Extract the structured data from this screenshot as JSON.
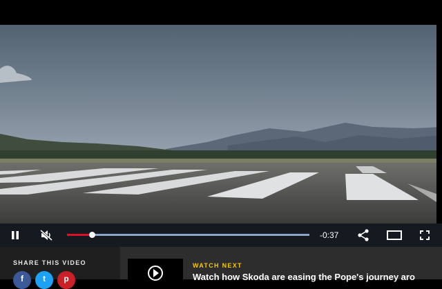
{
  "player": {
    "progress_fraction": 0.102,
    "time_remaining": "-0:37",
    "muted": true,
    "playing": true
  },
  "icons": {
    "pause": "pause-icon",
    "mute": "muted-speaker-icon",
    "share": "share-icon",
    "theater": "theater-mode-icon",
    "fullscreen": "fullscreen-icon"
  },
  "share": {
    "title": "SHARE THIS VIDEO",
    "networks": [
      {
        "name": "facebook",
        "glyph": "f",
        "color": "#3b5998"
      },
      {
        "name": "twitter",
        "glyph": "t",
        "color": "#1da1f2"
      },
      {
        "name": "pinterest",
        "glyph": "p",
        "color": "#cb2027"
      }
    ]
  },
  "up_next": {
    "label": "WATCH NEXT",
    "title": "Watch how Skoda are easing the Pope's journey aro"
  },
  "colors": {
    "progress_fill": "#e0102a",
    "progress_track": "#8ea3c9",
    "accent_label": "#f3c813"
  }
}
